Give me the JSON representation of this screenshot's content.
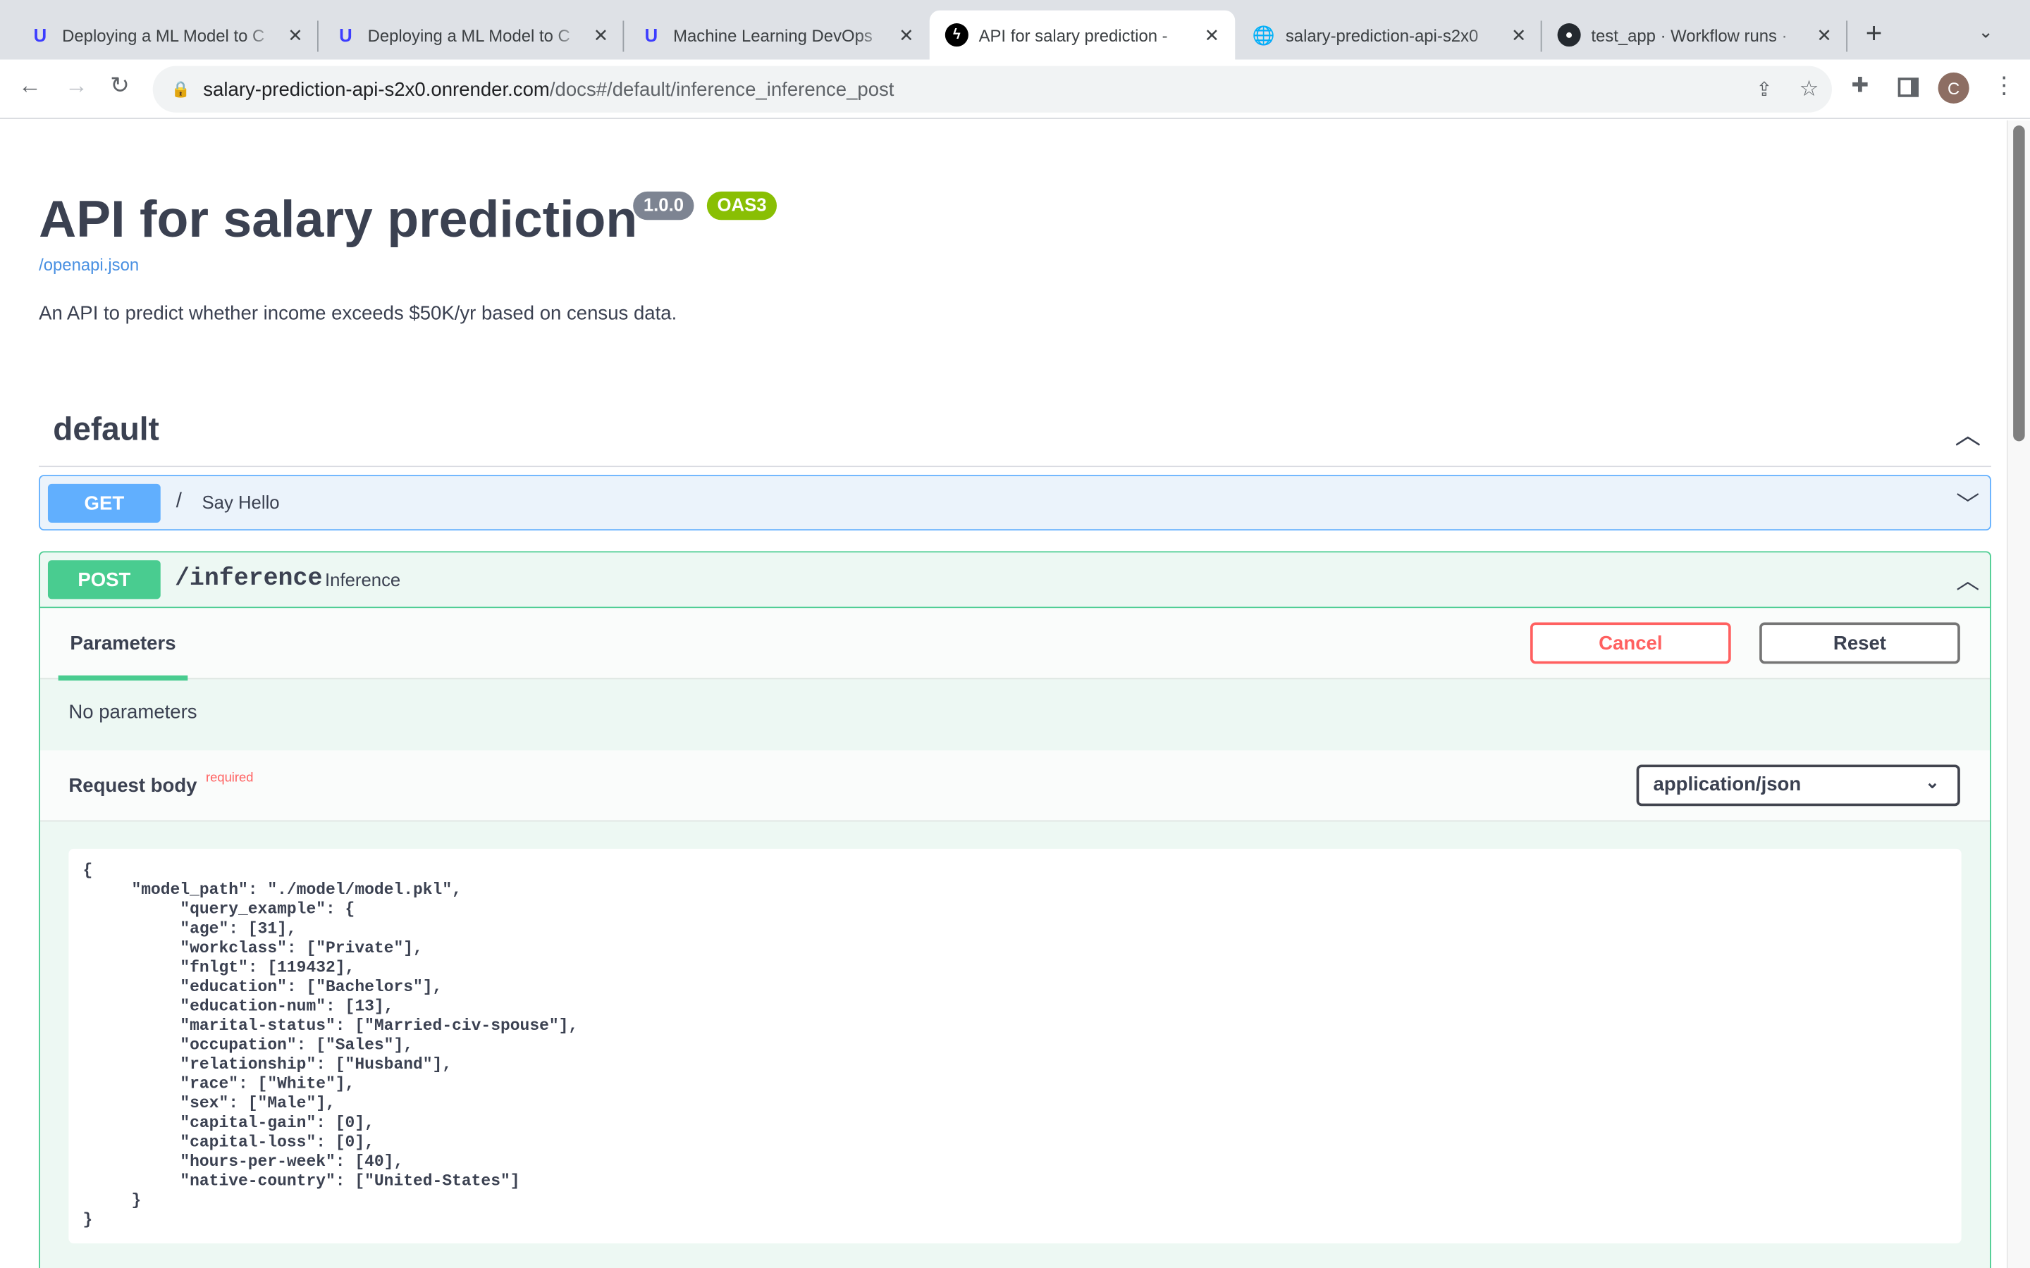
{
  "browser": {
    "tabs": [
      {
        "title": "Deploying a ML Model to C",
        "icon": "udacity-icon"
      },
      {
        "title": "Deploying a ML Model to C",
        "icon": "udacity-icon"
      },
      {
        "title": "Machine Learning DevOps",
        "icon": "udacity-icon"
      },
      {
        "title": "API for salary prediction -",
        "icon": "fastapi-icon",
        "active": true
      },
      {
        "title": "salary-prediction-api-s2x0",
        "icon": "globe-icon"
      },
      {
        "title": "test_app · Workflow runs ·",
        "icon": "github-icon"
      }
    ],
    "url_host": "salary-prediction-api-s2x0.onrender.com",
    "url_path": "/docs#/default/inference_inference_post",
    "profile_initial": "C"
  },
  "info": {
    "title": "API for salary prediction",
    "version": "1.0.0",
    "oas": "OAS3",
    "spec_link": "/openapi.json",
    "description": "An API to predict whether income exceeds $50K/yr based on census data."
  },
  "tag": {
    "name": "default"
  },
  "colors": {
    "get": "#61affe",
    "post": "#49cc90",
    "cancel": "#ff6060",
    "version_badge": "#7d8492",
    "oas_badge": "#89bf04"
  },
  "get_op": {
    "method": "GET",
    "path": "/",
    "summary": "Say Hello"
  },
  "post_op": {
    "method": "POST",
    "path": "/inference",
    "summary": "Inference",
    "params_tab": "Parameters",
    "cancel": "Cancel",
    "reset": "Reset",
    "no_params": "No parameters",
    "request_body": "Request body",
    "required": "required",
    "content_type": "application/json",
    "body": "{\n     \"model_path\": \"./model/model.pkl\",\n          \"query_example\": {\n          \"age\": [31],\n          \"workclass\": [\"Private\"],\n          \"fnlgt\": [119432],\n          \"education\": [\"Bachelors\"],\n          \"education-num\": [13],\n          \"marital-status\": [\"Married-civ-spouse\"],\n          \"occupation\": [\"Sales\"],\n          \"relationship\": [\"Husband\"],\n          \"race\": [\"White\"],\n          \"sex\": [\"Male\"],\n          \"capital-gain\": [0],\n          \"capital-loss\": [0],\n          \"hours-per-week\": [40],\n          \"native-country\": [\"United-States\"]\n     }\n}"
  }
}
